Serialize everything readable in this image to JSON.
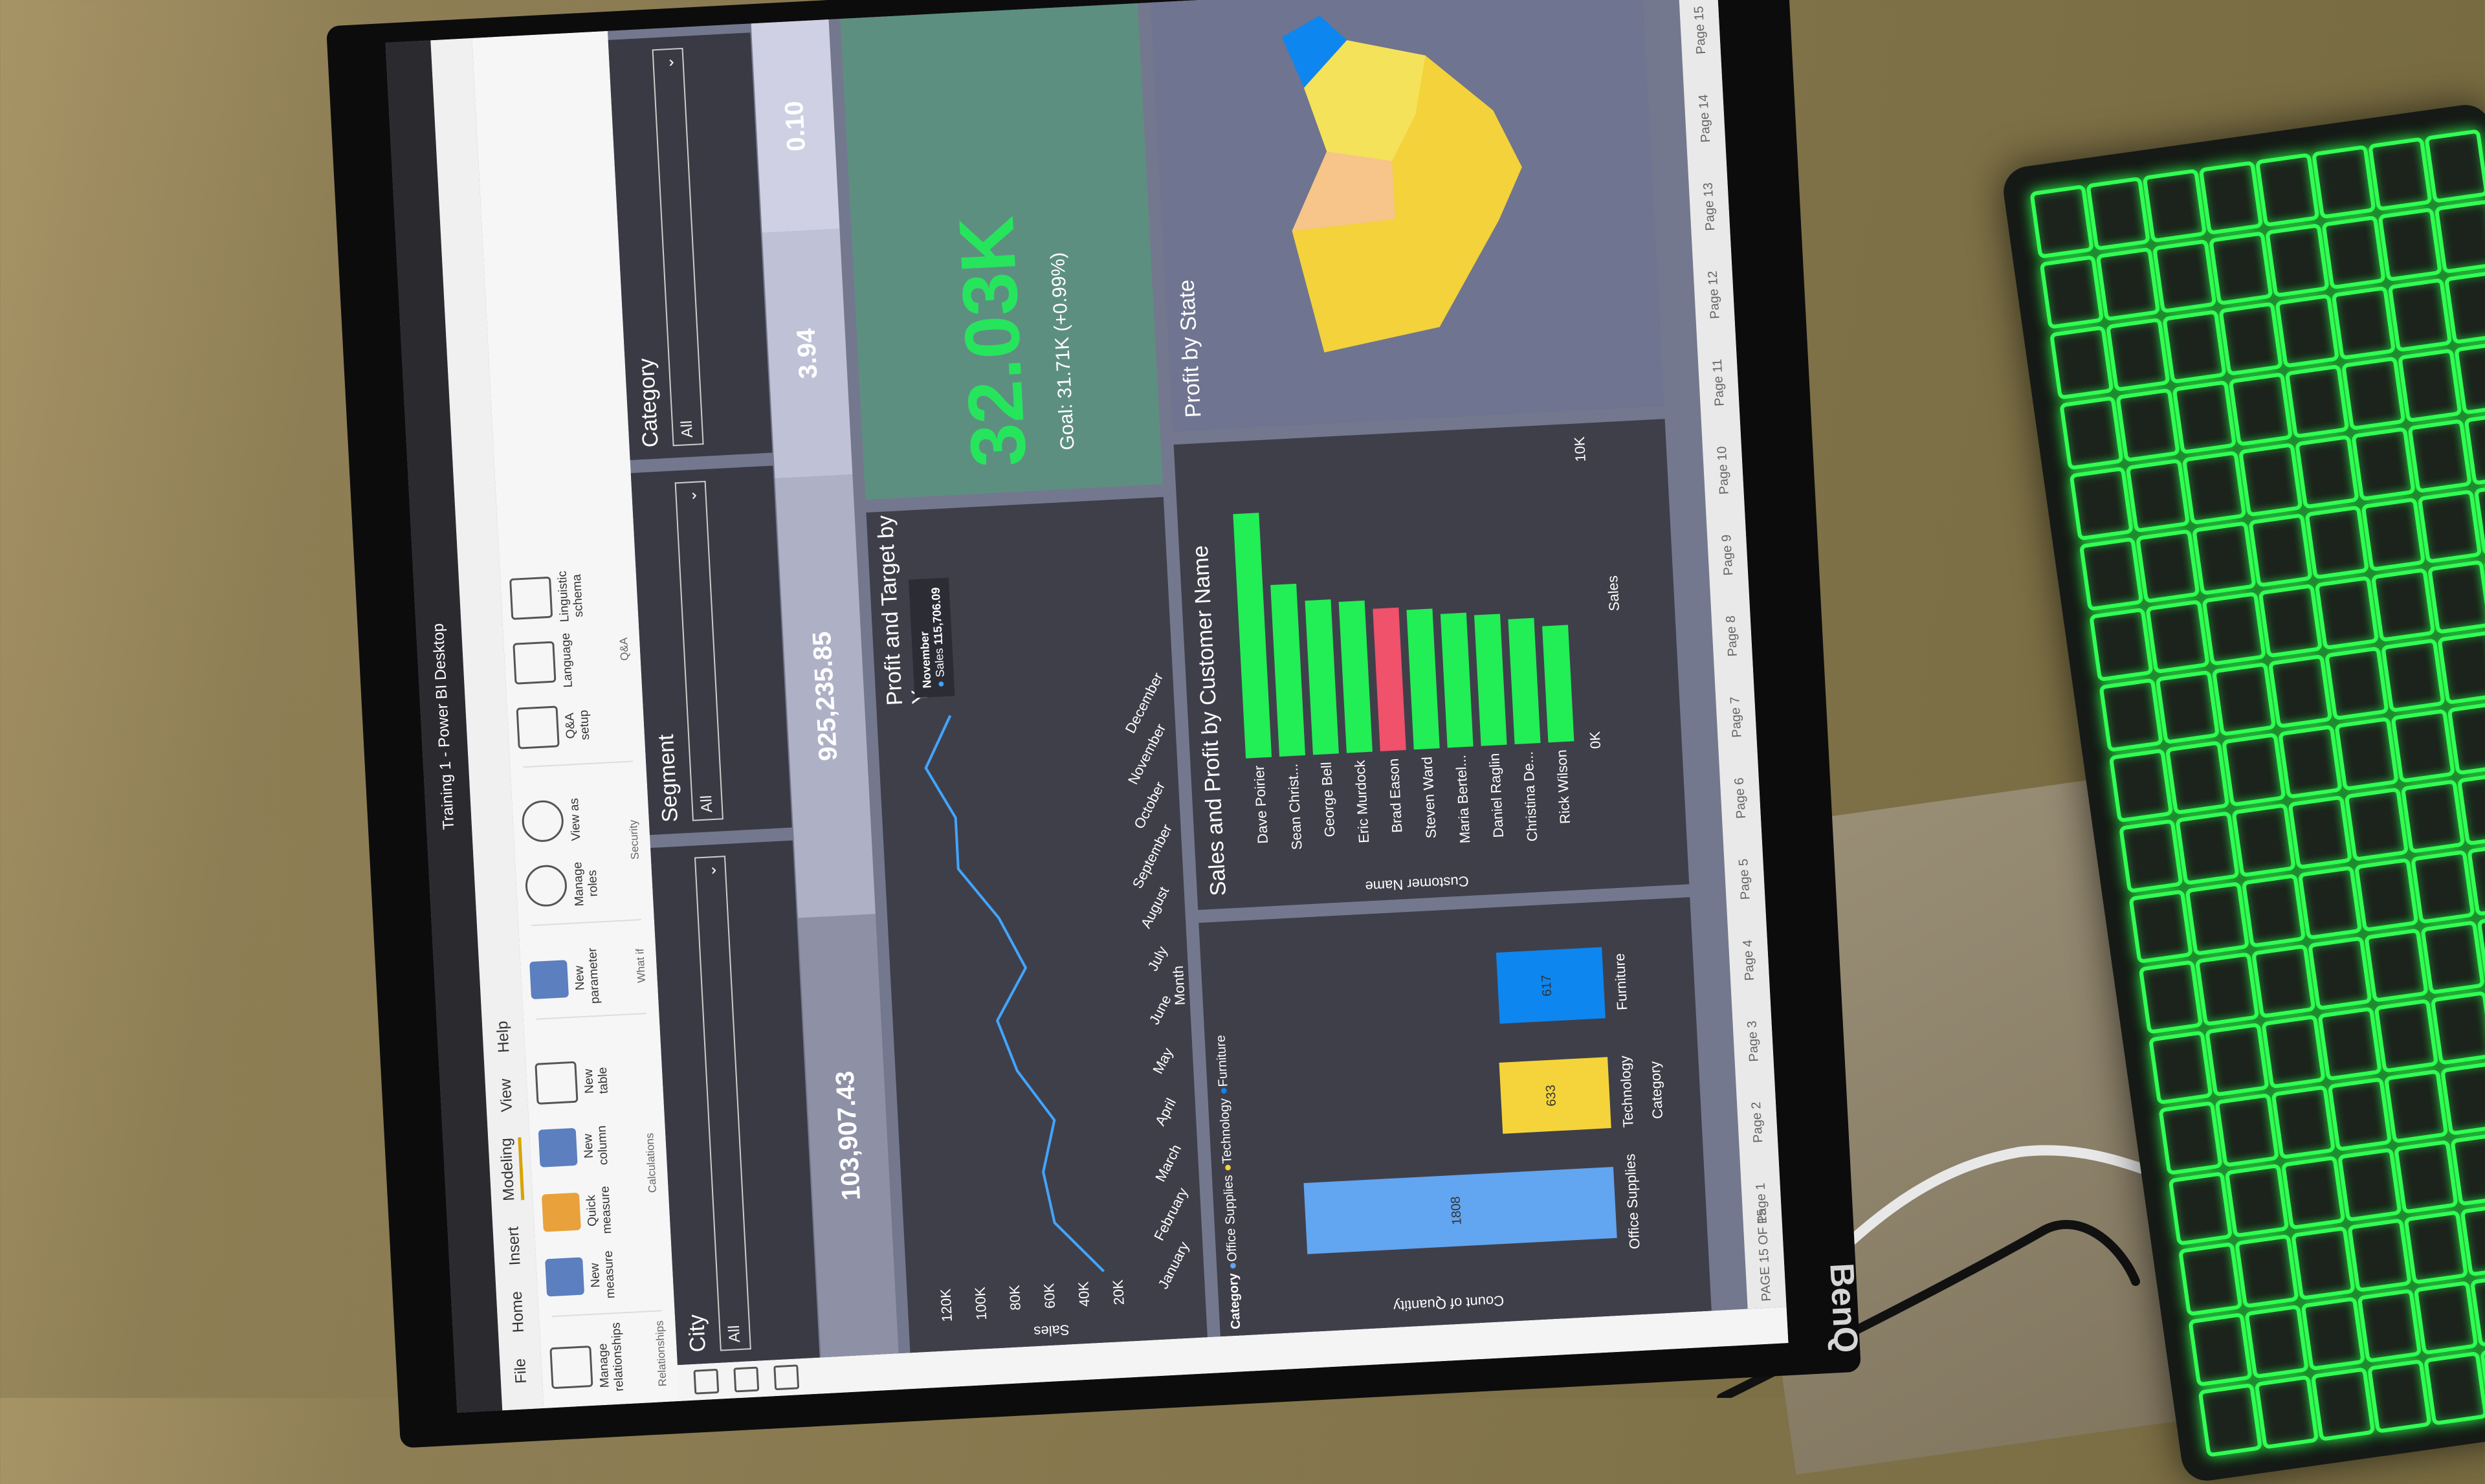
{
  "app": {
    "window_title": "Training 1 - Power BI Desktop",
    "ribbon_tabs": [
      "File",
      "Home",
      "Insert",
      "Modeling",
      "View",
      "Help"
    ],
    "active_tab": "Modeling",
    "ribbon": {
      "relationships": {
        "button": "Manage relationships",
        "group": "Relationships"
      },
      "calculations": {
        "buttons": [
          "New measure",
          "Quick measure",
          "New column",
          "New table"
        ],
        "group": "Calculations"
      },
      "whatif": {
        "button": "New parameter",
        "group": "What if"
      },
      "security": {
        "buttons": [
          "Manage roles",
          "View as"
        ],
        "group": "Security"
      },
      "qa": {
        "buttons": [
          "Q&A setup",
          "Language",
          "Linguistic schema"
        ],
        "group": "Q&A"
      }
    }
  },
  "slicers": [
    {
      "title": "City",
      "value": "All"
    },
    {
      "title": "Segment",
      "value": "All"
    },
    {
      "title": "Category",
      "value": "All"
    }
  ],
  "kpis": [
    "103,907.43",
    "925,235.85",
    "3.94",
    "0.10"
  ],
  "line_chart": {
    "title": "Profit and Target by Year",
    "ylabel": "Sales",
    "xlabel": "Month",
    "y_ticks": [
      "20K",
      "40K",
      "60K",
      "80K",
      "100K",
      "120K"
    ],
    "tooltip": {
      "month": "November",
      "label": "Sales",
      "value": "115,706.09"
    }
  },
  "gauge": {
    "value": "32.03K",
    "goal": "Goal: 31.71K (+0.99%)"
  },
  "map": {
    "title": "Profit by State"
  },
  "column_chart": {
    "ylabel": "Count of Quantity",
    "xlabel": "Category",
    "legend_title": "Category",
    "legend": [
      "Office Supplies",
      "Technology",
      "Furniture"
    ]
  },
  "bar_chart": {
    "title": "Sales and Profit by Customer Name",
    "ylabel": "Customer Name",
    "xlabel": "Sales",
    "x_ticks": [
      "0K",
      "10K"
    ]
  },
  "page_tabs": [
    "Page 1",
    "Page 2",
    "Page 3",
    "Page 4",
    "Page 5",
    "Page 6",
    "Page 7",
    "Page 8",
    "Page 9",
    "Page 10",
    "Page 11",
    "Page 12",
    "Page 13",
    "Page 14",
    "Page 15"
  ],
  "page_status": "PAGE 15 OF 15",
  "monitor_brand": "BenQ",
  "chart_data": [
    {
      "type": "line",
      "title": "Profit and Target by Year",
      "xlabel": "Month",
      "ylabel": "Sales",
      "x": [
        "January",
        "February",
        "March",
        "April",
        "May",
        "June",
        "July",
        "August",
        "September",
        "October",
        "November",
        "December"
      ],
      "series": [
        {
          "name": "Sales",
          "values": [
            28000,
            55000,
            60000,
            52000,
            72000,
            82000,
            64000,
            78000,
            100000,
            100000,
            115706.09,
            100000
          ]
        }
      ],
      "ylim": [
        0,
        120000
      ]
    },
    {
      "type": "bar",
      "xlabel": "Category",
      "ylabel": "Count of Quantity",
      "categories": [
        "Office Supplies",
        "Technology",
        "Furniture"
      ],
      "values": [
        1808,
        633,
        617
      ],
      "colors": [
        "#62a5f0",
        "#f4d43a",
        "#0d86f0"
      ]
    },
    {
      "type": "bar",
      "title": "Sales and Profit by Customer Name",
      "xlabel": "Sales",
      "ylabel": "Customer Name",
      "categories": [
        "Dave Poirier",
        "Sean Christ...",
        "George Bell",
        "Eric Murdock",
        "Brad Eason",
        "Steven Ward",
        "Maria Bertel...",
        "Daniel Raglin",
        "Christina De...",
        "Rick Wilson"
      ],
      "values": [
        8400,
        5900,
        5300,
        5200,
        4900,
        4800,
        4600,
        4500,
        4300,
        4000
      ],
      "colors": [
        "#22ee55",
        "#22ee55",
        "#22ee55",
        "#22ee55",
        "#f0516b",
        "#22ee55",
        "#22ee55",
        "#22ee55",
        "#22ee55",
        "#22ee55"
      ],
      "xlim": [
        0,
        10000
      ]
    }
  ]
}
